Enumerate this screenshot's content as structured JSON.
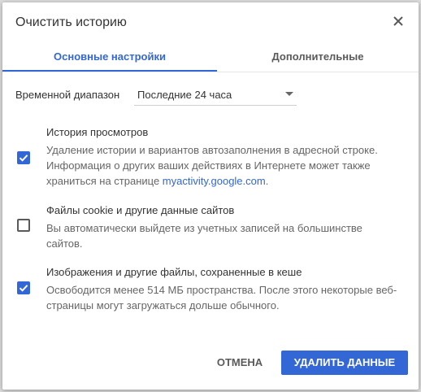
{
  "dialog": {
    "title": "Очистить историю",
    "close_icon": "close-icon"
  },
  "tabs": [
    {
      "label": "Основные настройки",
      "active": true
    },
    {
      "label": "Дополнительные",
      "active": false
    }
  ],
  "time_range": {
    "label": "Временной диапазон",
    "selected": "Последние 24 часа"
  },
  "options": [
    {
      "title": "История просмотров",
      "description": "Удаление истории и вариантов автозаполнения в адресной строке. Информация о других ваших действиях в Интернете может также храниться на странице ",
      "link": "myactivity.google.com",
      "description_end": ".",
      "checked": true
    },
    {
      "title": "Файлы cookie и другие данные сайтов",
      "description": "Вы автоматически выйдете из учетных записей на большинстве сайтов.",
      "checked": false
    },
    {
      "title": "Изображения и другие файлы, сохраненные в кеше",
      "description": "Освободится менее 514 МБ пространства. После этого некоторые веб-страницы могут загружаться дольше обычного.",
      "checked": true
    }
  ],
  "footer": {
    "cancel_label": "Отмена",
    "clear_label": "Удалить данные"
  },
  "colors": {
    "accent": "#3367d6",
    "text_primary": "#333333",
    "text_secondary": "#666666"
  }
}
